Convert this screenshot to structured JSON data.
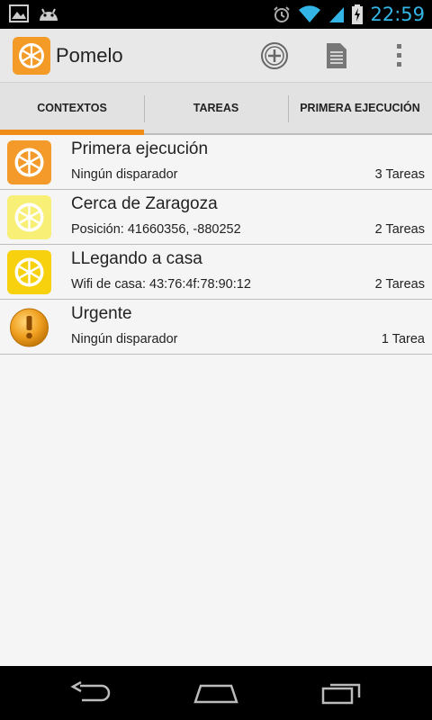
{
  "status_bar": {
    "time": "22:59"
  },
  "app": {
    "title": "Pomelo"
  },
  "tabs": [
    {
      "label": "CONTEXTOS"
    },
    {
      "label": "TAREAS"
    },
    {
      "label": "PRIMERA EJECUCIÓN"
    }
  ],
  "contexts": [
    {
      "title": "Primera ejecución",
      "subtitle": "Ningún disparador",
      "count": "3 Tareas",
      "icon": "orange-slice-icon"
    },
    {
      "title": "Cerca de Zaragoza",
      "subtitle": "Posición: 41660356, -880252",
      "count": "2 Tareas",
      "icon": "lemon-slice-icon"
    },
    {
      "title": "LLegando a casa",
      "subtitle": "Wifi de casa: 43:76:4f:78:90:12",
      "count": "2 Tareas",
      "icon": "yellow-slice-icon"
    },
    {
      "title": "Urgente",
      "subtitle": "Ningún disparador",
      "count": "1 Tarea",
      "icon": "warning-icon"
    }
  ],
  "colors": {
    "accent": "#f08c18",
    "status_blue": "#33b5e5"
  }
}
